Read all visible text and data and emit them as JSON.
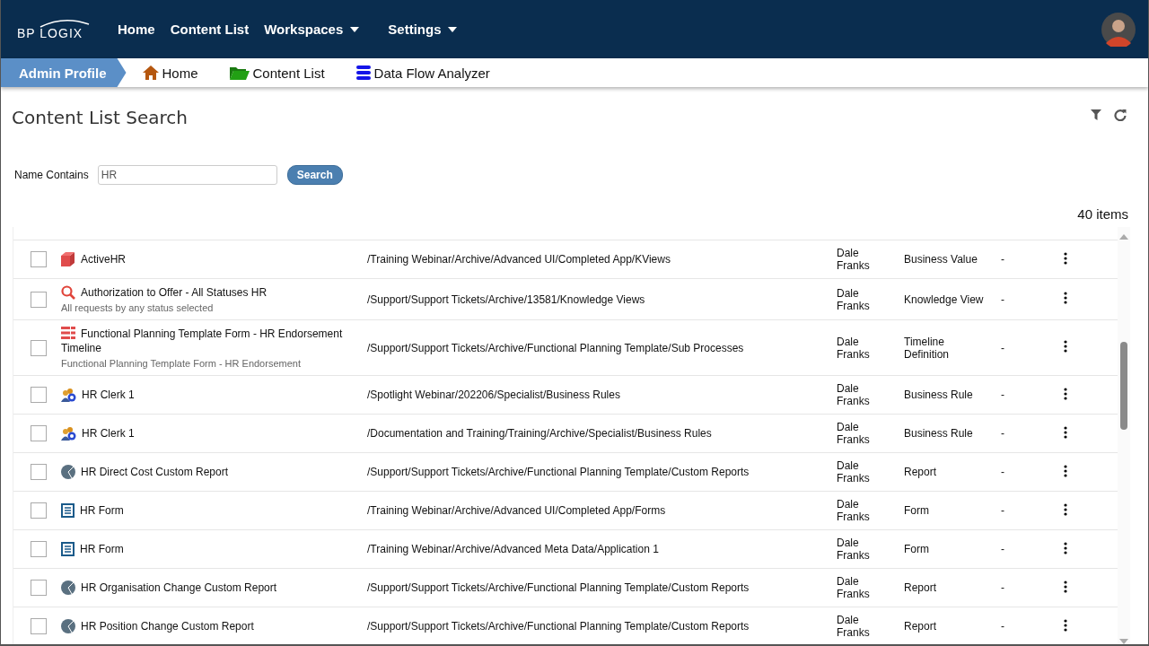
{
  "topnav": {
    "logo": "BP LOGIX",
    "items": [
      {
        "label": "Home",
        "dropdown": false
      },
      {
        "label": "Content List",
        "dropdown": false
      },
      {
        "label": "Workspaces",
        "dropdown": true
      },
      {
        "label": "Settings",
        "dropdown": true
      }
    ]
  },
  "breadcrumb": {
    "profile": "Admin Profile",
    "links": [
      {
        "label": "Home",
        "kind": "home"
      },
      {
        "label": "Content List",
        "kind": "folder"
      },
      {
        "label": "Data Flow Analyzer",
        "kind": "database"
      }
    ]
  },
  "page_title": "Content List Search",
  "search": {
    "label": "Name Contains",
    "value": "HR",
    "button": "Search"
  },
  "count": "40 items",
  "rows": [
    {
      "kind": "business-value",
      "name": "ActiveHR",
      "description": "",
      "path": "/Training Webinar/Archive/Advanced UI/Completed App/KViews",
      "owner": "Dale Franks",
      "type": "Business Value",
      "status": "-",
      "checked": false
    },
    {
      "kind": "knowledge-view",
      "name": "Authorization to Offer - All Statuses HR",
      "description": "All requests by any status selected",
      "path": "/Support/Support Tickets/Archive/13581/Knowledge Views",
      "owner": "Dale Franks",
      "type": "Knowledge View",
      "status": "-",
      "checked": false
    },
    {
      "kind": "timeline",
      "name": "Functional Planning Template Form - HR Endorsement Timeline",
      "description": "Functional Planning Template Form - HR Endorsement",
      "path": "/Support/Support Tickets/Archive/Functional Planning Template/Sub Processes",
      "owner": "Dale Franks",
      "type": "Timeline Definition",
      "status": "-",
      "checked": false
    },
    {
      "kind": "business-rule",
      "name": "HR Clerk 1",
      "description": "",
      "path": "/Spotlight Webinar/202206/Specialist/Business Rules",
      "owner": "Dale Franks",
      "type": "Business Rule",
      "status": "-",
      "checked": false
    },
    {
      "kind": "business-rule",
      "name": "HR Clerk 1",
      "description": "",
      "path": "/Documentation and Training/Training/Archive/Specialist/Business Rules",
      "owner": "Dale Franks",
      "type": "Business Rule",
      "status": "-",
      "checked": false
    },
    {
      "kind": "report",
      "name": "HR Direct Cost Custom Report",
      "description": "",
      "path": "/Support/Support Tickets/Archive/Functional Planning Template/Custom Reports",
      "owner": "Dale Franks",
      "type": "Report",
      "status": "-",
      "checked": false
    },
    {
      "kind": "form",
      "name": "HR Form",
      "description": "",
      "path": "/Training Webinar/Archive/Advanced UI/Completed App/Forms",
      "owner": "Dale Franks",
      "type": "Form",
      "status": "-",
      "checked": false
    },
    {
      "kind": "form",
      "name": "HR Form",
      "description": "",
      "path": "/Training Webinar/Archive/Advanced Meta Data/Application 1",
      "owner": "Dale Franks",
      "type": "Form",
      "status": "-",
      "checked": false
    },
    {
      "kind": "report",
      "name": "HR Organisation Change Custom Report",
      "description": "",
      "path": "/Support/Support Tickets/Archive/Functional Planning Template/Custom Reports",
      "owner": "Dale Franks",
      "type": "Report",
      "status": "-",
      "checked": false
    },
    {
      "kind": "report",
      "name": "HR Position Change Custom Report",
      "description": "",
      "path": "/Support/Support Tickets/Archive/Functional Planning Template/Custom Reports",
      "owner": "Dale Franks",
      "type": "Report",
      "status": "-",
      "checked": false
    }
  ]
}
